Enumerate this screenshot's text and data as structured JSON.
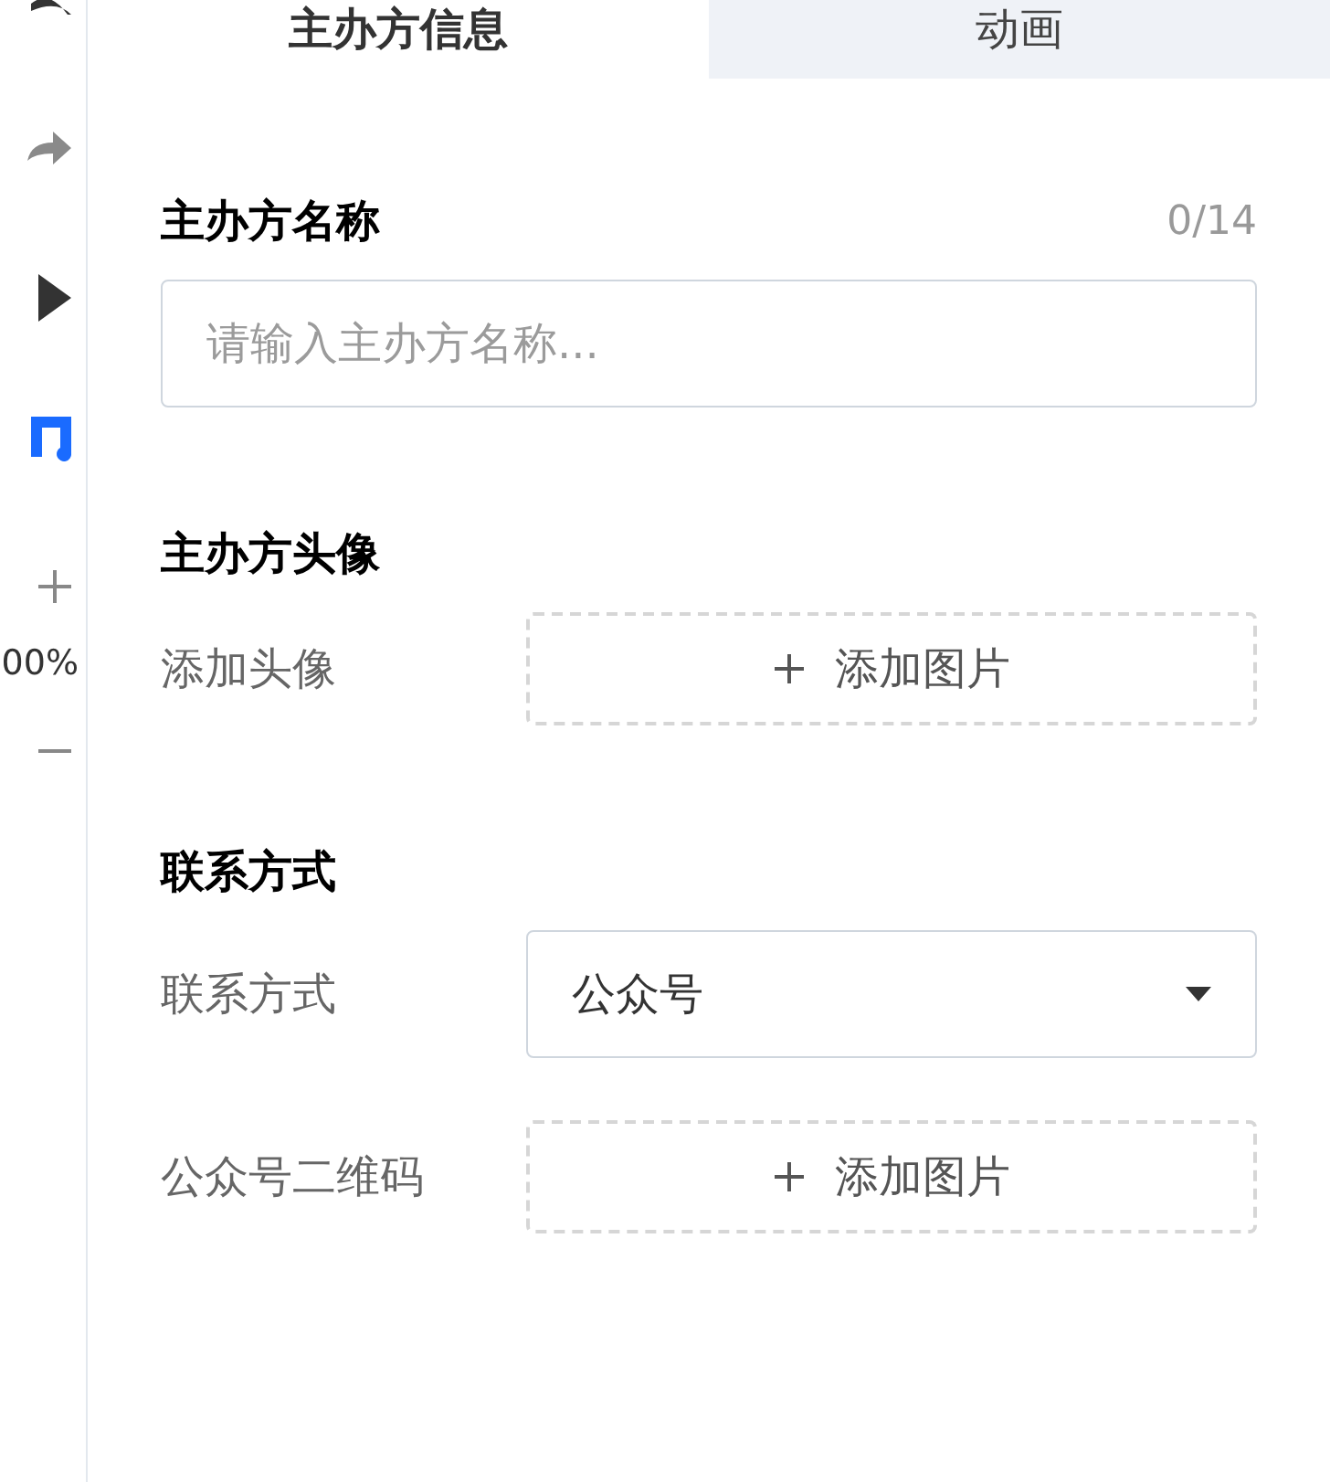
{
  "toolbar": {
    "zoom_text": "00%"
  },
  "tabs": [
    {
      "label": "主办方信息",
      "selected": true
    },
    {
      "label": "动画",
      "selected": false
    }
  ],
  "sections": [
    {
      "title": "主办方名称",
      "counter": "0/14",
      "rows": [
        {
          "kind": "text-input",
          "placeholder": "请输入主办方名称..."
        }
      ]
    },
    {
      "title": "主办方头像",
      "rows": [
        {
          "kind": "upload",
          "label": "添加头像",
          "button": "添加图片"
        }
      ]
    },
    {
      "title": "联系方式",
      "rows": [
        {
          "kind": "select",
          "label": "联系方式",
          "value": "公众号"
        },
        {
          "kind": "upload",
          "label": "公众号二维码",
          "button": "添加图片"
        }
      ]
    }
  ]
}
